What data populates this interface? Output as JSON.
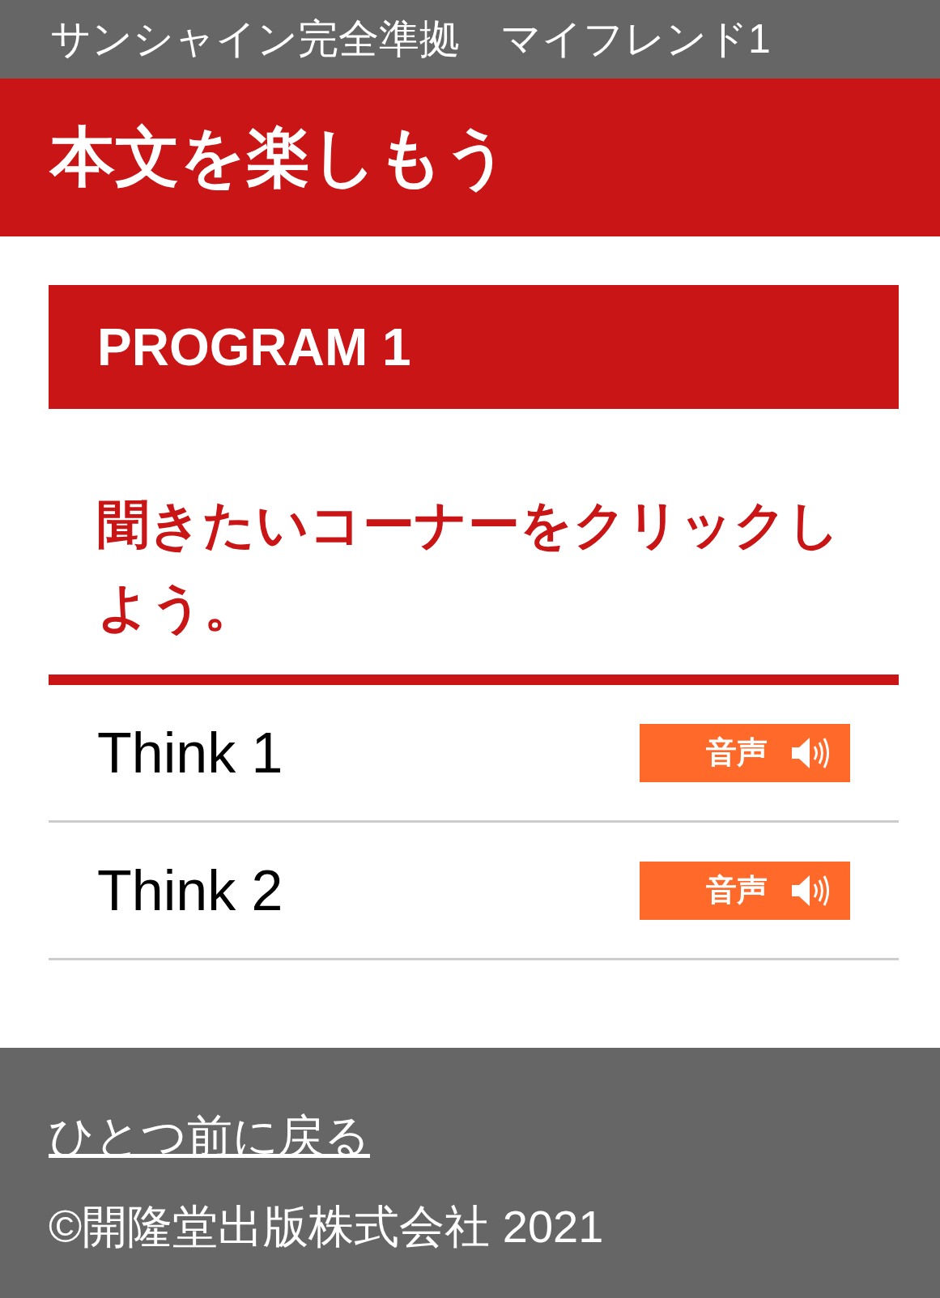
{
  "header": {
    "series": "サンシャイン完全準拠　マイフレンド1",
    "title": "本文を楽しもう"
  },
  "program": {
    "heading": "PROGRAM 1",
    "instruction": "聞きたいコーナーをクリックしよう。",
    "items": [
      {
        "label": "Think 1",
        "button": "音声"
      },
      {
        "label": "Think 2",
        "button": "音声"
      }
    ]
  },
  "footer": {
    "back_link": "ひとつ前に戻る",
    "copyright": "©開隆堂出版株式会社 2021"
  }
}
